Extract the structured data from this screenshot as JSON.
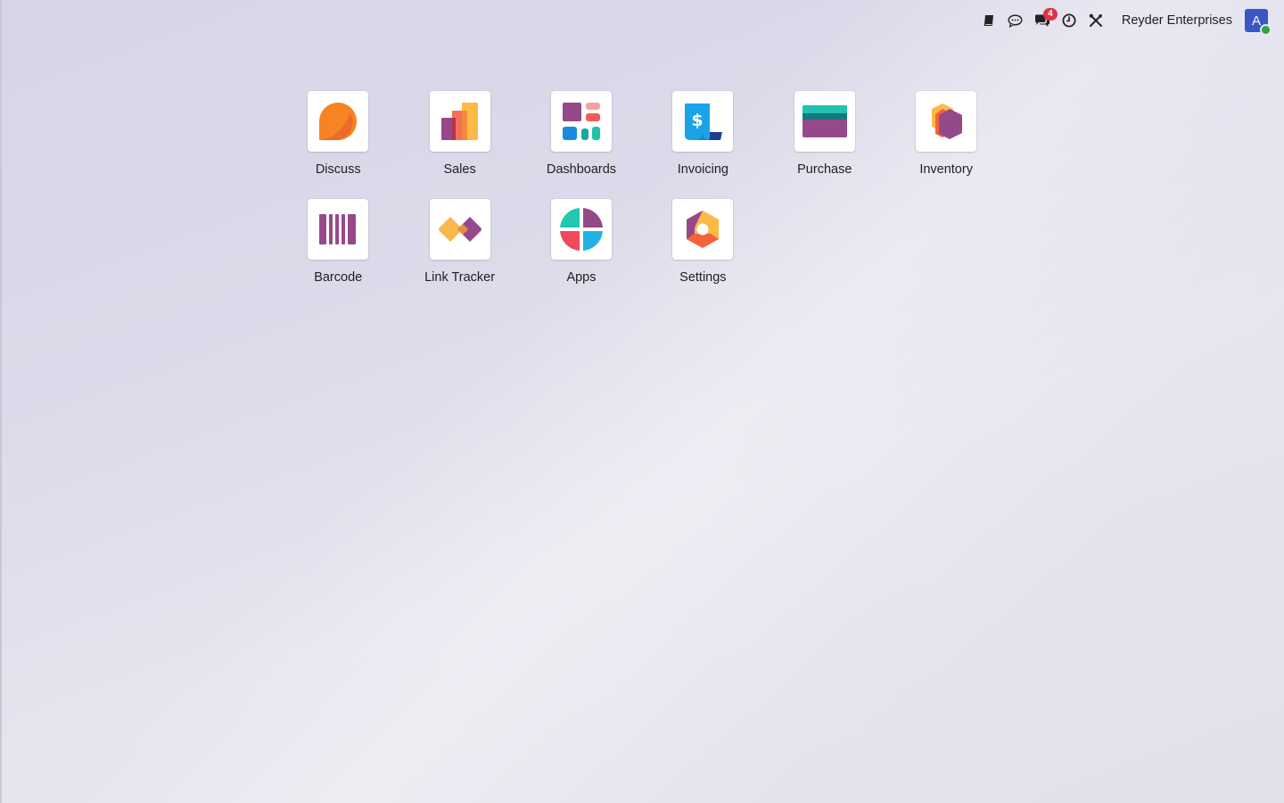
{
  "topbar": {
    "icons": [
      "book-icon",
      "chat-bubble-icon",
      "messages-icon",
      "clock-icon",
      "tools-icon"
    ],
    "messages_badge": "4",
    "company_name": "Reyder Enterprises",
    "avatar_letter": "A"
  },
  "apps": [
    {
      "label": "Discuss",
      "icon": "discuss-icon"
    },
    {
      "label": "Sales",
      "icon": "sales-icon"
    },
    {
      "label": "Dashboards",
      "icon": "dashboards-icon"
    },
    {
      "label": "Invoicing",
      "icon": "invoicing-icon"
    },
    {
      "label": "Purchase",
      "icon": "purchase-icon"
    },
    {
      "label": "Inventory",
      "icon": "inventory-icon"
    },
    {
      "label": "Barcode",
      "icon": "barcode-icon"
    },
    {
      "label": "Link Tracker",
      "icon": "link-tracker-icon"
    },
    {
      "label": "Apps",
      "icon": "apps-icon"
    },
    {
      "label": "Settings",
      "icon": "settings-icon"
    }
  ],
  "colors": {
    "badge": "#dc3545",
    "avatar": "#3b57c4",
    "status_online": "#28a745"
  }
}
